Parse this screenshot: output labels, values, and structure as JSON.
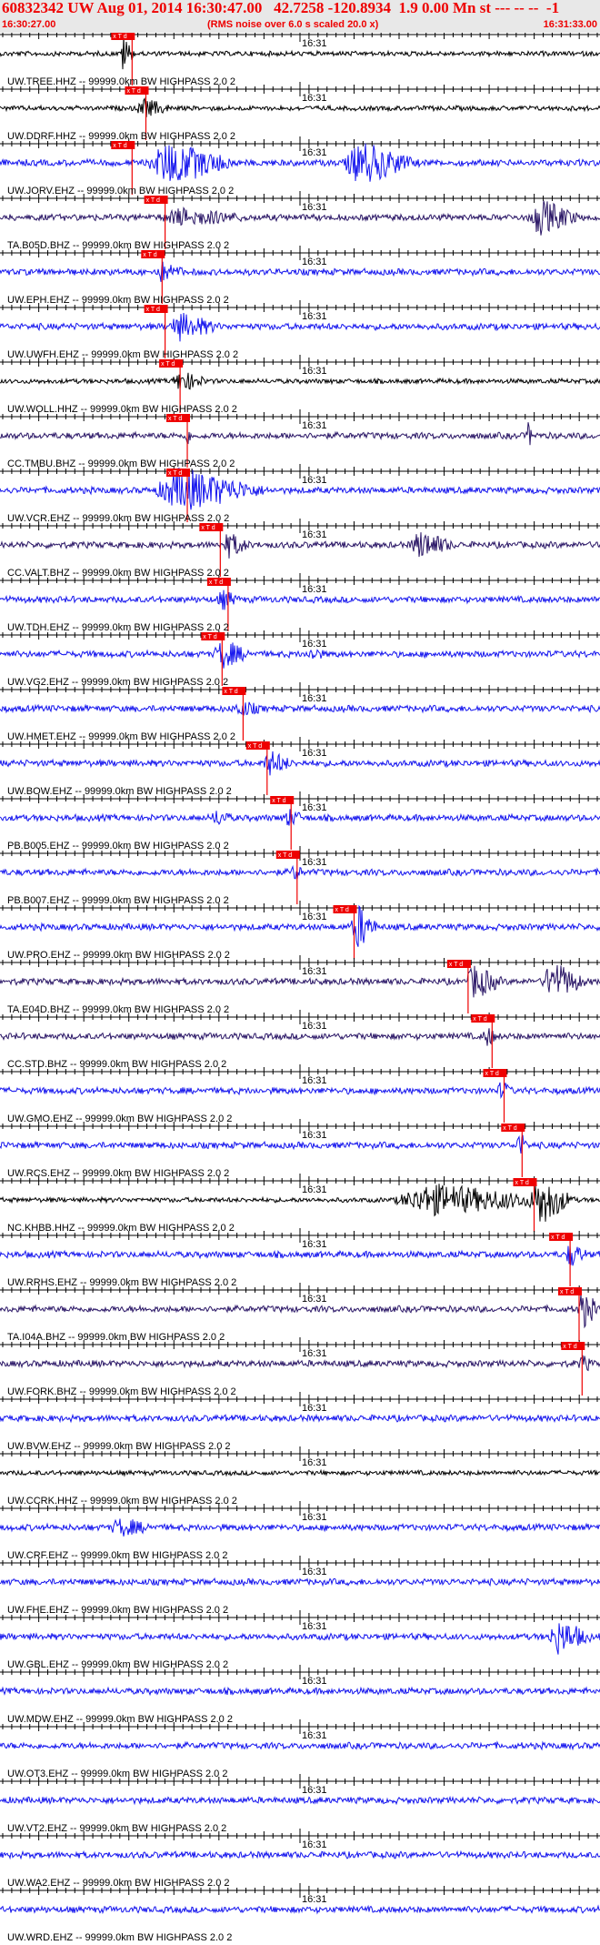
{
  "header": {
    "title": "60832342 UW Aug 01, 2014 16:30:47.00   42.7258 -120.8934  1.9 0.00 Mn st --- -- --  -1",
    "start_time": "16:30:27.00",
    "noise_note": "(RMS noise over 6.0 s scaled 20.0 x)",
    "end_time": "16:31:33.00"
  },
  "minute_label": "16:31",
  "pick_label": "x T d",
  "filter_suffix": " -- 99999.0km BW  HIGHPASS  2.0  2",
  "colors": {
    "blue": "#1515ee",
    "black": "#000000",
    "navy": "#2a1666",
    "red": "#ee0000",
    "header_bg": "#e8e8e8"
  },
  "traces": [
    {
      "station": "UW.TREE.HHZ",
      "color": "black",
      "pick": 0.205,
      "event": [
        {
          "c": 0.205,
          "w": 0.02,
          "a": 20
        }
      ]
    },
    {
      "station": "UW.DDRF.HHZ",
      "color": "black",
      "pick": 0.228,
      "event": [
        {
          "c": 0.24,
          "w": 0.05,
          "a": 9
        }
      ]
    },
    {
      "station": "UW.JORV.EHZ",
      "color": "blue",
      "pick": 0.205,
      "event": [
        {
          "c": 0.28,
          "w": 0.12,
          "a": 22
        },
        {
          "c": 0.6,
          "w": 0.1,
          "a": 22
        }
      ]
    },
    {
      "station": "TA.B05D.BHZ",
      "color": "navy",
      "pick": 0.26,
      "event": [
        {
          "c": 0.3,
          "w": 0.12,
          "a": 8
        },
        {
          "c": 0.9,
          "w": 0.07,
          "a": 18
        }
      ]
    },
    {
      "station": "UW.EPH.EHZ",
      "color": "blue",
      "pick": 0.255,
      "event": [
        {
          "c": 0.27,
          "w": 0.04,
          "a": 9
        }
      ]
    },
    {
      "station": "UW.UWFH.EHZ",
      "color": "blue",
      "pick": 0.26,
      "event": [
        {
          "c": 0.3,
          "w": 0.07,
          "a": 13
        }
      ]
    },
    {
      "station": "UW.WOLL.HHZ",
      "color": "black",
      "pick": 0.285,
      "event": [
        {
          "c": 0.3,
          "w": 0.05,
          "a": 10
        }
      ]
    },
    {
      "station": "CC.TMBU.BHZ",
      "color": "navy",
      "pick": 0.297,
      "event": [
        {
          "c": 0.31,
          "w": 0.01,
          "a": 10
        },
        {
          "c": 0.88,
          "w": 0.01,
          "a": 13
        }
      ]
    },
    {
      "station": "UW.VCR.EHZ",
      "color": "blue",
      "pick": 0.297,
      "event": [
        {
          "c": 0.3,
          "w": 0.15,
          "a": 22
        }
      ]
    },
    {
      "station": "CC.VALT.BHZ",
      "color": "navy",
      "pick": 0.352,
      "event": [
        {
          "c": 0.38,
          "w": 0.04,
          "a": 12
        },
        {
          "c": 0.7,
          "w": 0.06,
          "a": 14
        }
      ]
    },
    {
      "station": "UW.TDH.EHZ",
      "color": "blue",
      "pick": 0.365,
      "event": [
        {
          "c": 0.37,
          "w": 0.03,
          "a": 9
        }
      ]
    },
    {
      "station": "UW.VG2.EHZ",
      "color": "blue",
      "pick": 0.355,
      "event": [
        {
          "c": 0.37,
          "w": 0.05,
          "a": 14
        },
        {
          "c": 0.52,
          "w": 0.02,
          "a": 7
        }
      ]
    },
    {
      "station": "UW.HMET.EHZ",
      "color": "blue",
      "pick": 0.39,
      "event": [
        {
          "c": 0.4,
          "w": 0.04,
          "a": 7
        }
      ]
    },
    {
      "station": "UW.BOW.EHZ",
      "color": "blue",
      "pick": 0.43,
      "event": [
        {
          "c": 0.45,
          "w": 0.04,
          "a": 12
        }
      ]
    },
    {
      "station": "PB.B005.EHZ",
      "color": "blue",
      "pick": 0.47,
      "event": [
        {
          "c": 0.36,
          "w": 0.03,
          "a": 7
        },
        {
          "c": 0.48,
          "w": 0.03,
          "a": 8
        }
      ]
    },
    {
      "station": "PB.B007.EHZ",
      "color": "blue",
      "pick": 0.48,
      "event": [
        {
          "c": 0.49,
          "w": 0.015,
          "a": 10
        }
      ]
    },
    {
      "station": "UW.PRO.EHZ",
      "color": "blue",
      "pick": 0.575,
      "event": [
        {
          "c": 0.595,
          "w": 0.035,
          "a": 24
        }
      ]
    },
    {
      "station": "TA.E04D.BHZ",
      "color": "navy",
      "pick": 0.765,
      "event": [
        {
          "c": 0.79,
          "w": 0.05,
          "a": 17
        },
        {
          "c": 0.92,
          "w": 0.06,
          "a": 20
        }
      ]
    },
    {
      "station": "CC.STD.BHZ",
      "color": "navy",
      "pick": 0.805,
      "event": [
        {
          "c": 0.81,
          "w": 0.02,
          "a": 10
        }
      ]
    },
    {
      "station": "UW.GMO.EHZ",
      "color": "blue",
      "pick": 0.825,
      "event": [
        {
          "c": 0.835,
          "w": 0.02,
          "a": 9
        }
      ]
    },
    {
      "station": "UW.RCS.EHZ",
      "color": "blue",
      "pick": 0.855,
      "event": [
        {
          "c": 0.865,
          "w": 0.015,
          "a": 14
        }
      ]
    },
    {
      "station": "NC.KHBB.HHZ",
      "color": "black",
      "pick": 0.875,
      "event": [
        {
          "c": 0.72,
          "w": 0.22,
          "a": 16
        },
        {
          "c": 0.9,
          "w": 0.06,
          "a": 24
        }
      ]
    },
    {
      "station": "UW.RRHS.EHZ",
      "color": "blue",
      "pick": 0.935,
      "event": [
        {
          "c": 0.95,
          "w": 0.03,
          "a": 12
        }
      ]
    },
    {
      "station": "TA.I04A.BHZ",
      "color": "navy",
      "pick": 0.95,
      "event": [
        {
          "c": 0.97,
          "w": 0.03,
          "a": 20
        }
      ]
    },
    {
      "station": "UW.FORK.BHZ",
      "color": "navy",
      "pick": 0.955,
      "event": [
        {
          "c": 0.97,
          "w": 0.02,
          "a": 8
        }
      ]
    },
    {
      "station": "UW.BVW.EHZ",
      "color": "blue",
      "pick": null,
      "event": []
    },
    {
      "station": "UW.CCRK.HHZ",
      "color": "black",
      "pick": null,
      "event": []
    },
    {
      "station": "UW.CRF.EHZ",
      "color": "blue",
      "pick": null,
      "event": [
        {
          "c": 0.2,
          "w": 0.06,
          "a": 8
        }
      ]
    },
    {
      "station": "UW.FHE.EHZ",
      "color": "blue",
      "pick": null,
      "event": []
    },
    {
      "station": "UW.GBL.EHZ",
      "color": "blue",
      "pick": null,
      "event": [
        {
          "c": 0.93,
          "w": 0.06,
          "a": 17
        }
      ]
    },
    {
      "station": "UW.MDW.EHZ",
      "color": "blue",
      "pick": null,
      "event": []
    },
    {
      "station": "UW.OT3.EHZ",
      "color": "blue",
      "pick": null,
      "event": []
    },
    {
      "station": "UW.VT2.EHZ",
      "color": "blue",
      "pick": null,
      "event": []
    },
    {
      "station": "UW.WA2.EHZ",
      "color": "blue",
      "pick": null,
      "event": []
    },
    {
      "station": "UW.WRD.EHZ",
      "color": "blue",
      "pick": null,
      "event": []
    }
  ]
}
